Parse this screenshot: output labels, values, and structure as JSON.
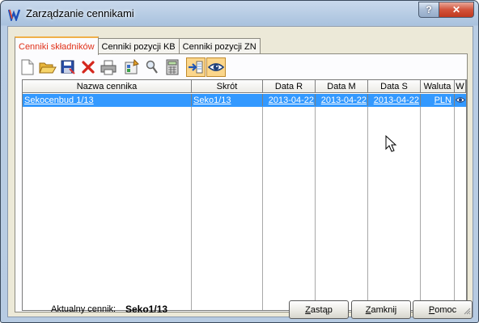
{
  "window": {
    "title": "Zarządzanie cennikami",
    "help_label": "?",
    "close_label": "✕"
  },
  "tabs": [
    {
      "label": "Cenniki składników",
      "active": true
    },
    {
      "label": "Cenniki pozycji KB",
      "active": false
    },
    {
      "label": "Cenniki pozycji ZN",
      "active": false
    }
  ],
  "toolbar": {
    "items": [
      "new-document-icon",
      "open-folder-icon",
      "save-icon",
      "delete-icon",
      "print-icon",
      "properties-icon",
      "search-icon",
      "calculator-icon",
      "import-icon",
      "view-icon"
    ]
  },
  "table": {
    "columns": [
      "Nazwa cennika",
      "Skrót",
      "Data R",
      "Data M",
      "Data S",
      "Waluta",
      "W"
    ],
    "rows": [
      {
        "nazwa": "Sekocenbud 1/13",
        "skrot": "Seko1/13",
        "data_r": "2013-04-22",
        "data_m": "2013-04-22",
        "data_s": "2013-04-22",
        "waluta": "PLN",
        "w": "eye-icon"
      }
    ]
  },
  "status": {
    "label": "Aktualny cennik:",
    "value": "Seko1/13"
  },
  "buttons": {
    "replace": {
      "underline": "Z",
      "rest": "astąp"
    },
    "close": {
      "underline": "Z",
      "rest": "amknij"
    },
    "help": {
      "underline": "P",
      "rest": "omoc"
    }
  },
  "colors": {
    "selection": "#3399ff",
    "active_tab_text": "#e03018",
    "toggle_on": "#fbd68b"
  }
}
